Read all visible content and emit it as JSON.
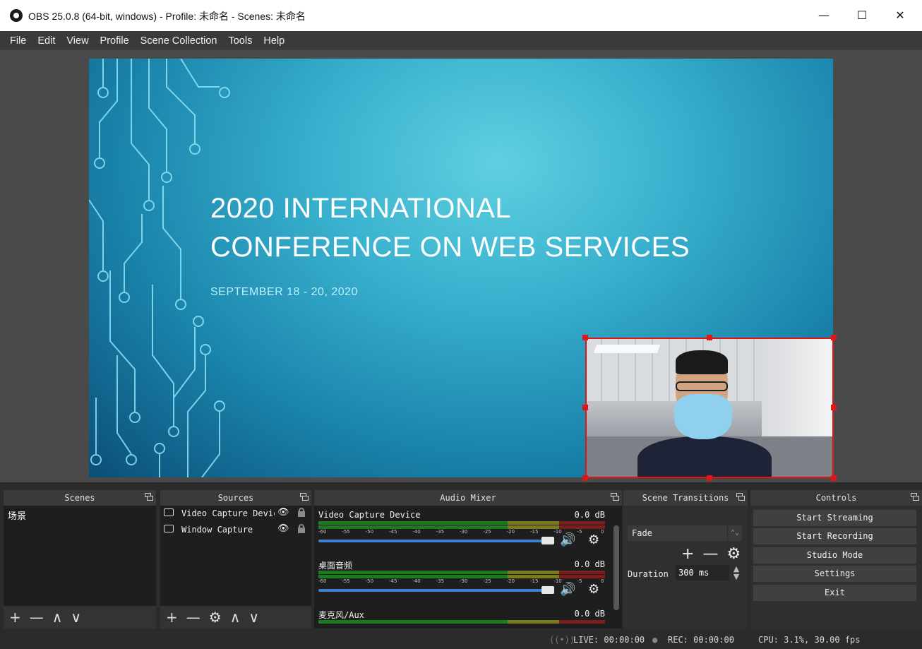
{
  "window": {
    "title": "OBS 25.0.8 (64-bit, windows) - Profile: 未命名 - Scenes: 未命名",
    "minimize": "—",
    "maximize": "☐",
    "close": "✕"
  },
  "menu": [
    "File",
    "Edit",
    "View",
    "Profile",
    "Scene Collection",
    "Tools",
    "Help"
  ],
  "preview": {
    "slide_title_line1": "2020 INTERNATIONAL",
    "slide_title_line2": "CONFERENCE ON WEB SERVICES",
    "slide_date": "SEPTEMBER 18 - 20, 2020"
  },
  "docks": {
    "scenes": {
      "title": "Scenes",
      "items": [
        "场景"
      ],
      "toolbar": [
        "+",
        "—",
        "∧",
        "∨"
      ]
    },
    "sources": {
      "title": "Sources",
      "items": [
        {
          "label": "Video Capture Device",
          "icon": "camera-icon"
        },
        {
          "label": "Window Capture",
          "icon": "window-icon"
        }
      ],
      "toolbar": [
        "+",
        "—",
        "⚙",
        "∧",
        "∨"
      ]
    },
    "mixer": {
      "title": "Audio Mixer",
      "channels": [
        {
          "name": "Video Capture Device",
          "db": "0.0 dB"
        },
        {
          "name": "桌面音频",
          "db": "0.0 dB"
        },
        {
          "name": "麦克风/Aux",
          "db": "0.0 dB"
        }
      ],
      "ticks": [
        "-60",
        "-55",
        "-50",
        "-45",
        "-40",
        "-35",
        "-30",
        "-25",
        "-20",
        "-15",
        "-10",
        "-5",
        "0"
      ]
    },
    "transitions": {
      "title": "Scene Transitions",
      "selected": "Fade",
      "duration_label": "Duration",
      "duration_value": "300 ms",
      "add": "+",
      "remove": "—",
      "settings": "⚙"
    },
    "controls": {
      "title": "Controls",
      "buttons": [
        "Start Streaming",
        "Start Recording",
        "Studio Mode",
        "Settings",
        "Exit"
      ]
    }
  },
  "status": {
    "live": "LIVE: 00:00:00",
    "rec": "REC: 00:00:00",
    "cpu": "CPU: 3.1%, 30.00 fps"
  }
}
